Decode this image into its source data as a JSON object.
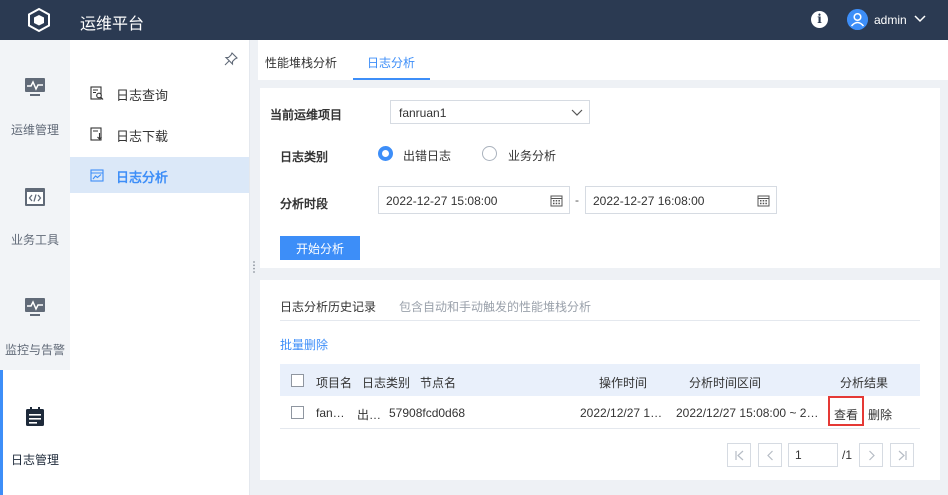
{
  "header": {
    "title": "运维平台",
    "user": "admin"
  },
  "leftnav": [
    {
      "label": "运维管理",
      "icon": "monitor-pulse-icon"
    },
    {
      "label": "业务工具",
      "icon": "code-window-icon"
    },
    {
      "label": "监控与告警",
      "icon": "monitor-alert-icon"
    },
    {
      "label": "日志管理",
      "icon": "calendar-log-icon",
      "active": true
    }
  ],
  "subnav": [
    {
      "label": "日志查询",
      "icon": "log-search-icon"
    },
    {
      "label": "日志下载",
      "icon": "log-download-icon"
    },
    {
      "label": "日志分析",
      "icon": "log-analysis-icon",
      "active": true
    }
  ],
  "tabs": [
    {
      "label": "性能堆栈分析"
    },
    {
      "label": "日志分析",
      "active": true
    }
  ],
  "form": {
    "project_label": "当前运维项目",
    "project_value": "fanruan1",
    "log_type_label": "日志类别",
    "log_type_options": [
      "出错日志",
      "业务分析"
    ],
    "log_type_selected": "出错日志",
    "period_label": "分析时段",
    "start_time": "2022-12-27 15:08:00",
    "end_time": "2022-12-27 16:08:00",
    "dash": "-",
    "start_button": "开始分析"
  },
  "history": {
    "title": "日志分析历史记录",
    "subtitle": "包含自动和手动触发的性能堆栈分析",
    "batch_delete": "批量删除",
    "columns": [
      "项目名",
      "日志类别",
      "节点名",
      "操作时间",
      "分析时间区间",
      "分析结果"
    ],
    "rows": [
      {
        "project": "fan…",
        "type": "出…",
        "node": "57908fcd0d68",
        "op_time": "2022/12/27 1…",
        "range": "2022/12/27 15:08:00 ~ 2…",
        "view": "查看",
        "delete": "删除"
      }
    ]
  },
  "pagination": {
    "current": "1",
    "total": "/1"
  },
  "colors": {
    "topbar": "#2b3a52",
    "accent": "#3d8ef8",
    "highlight": "#e53935"
  }
}
